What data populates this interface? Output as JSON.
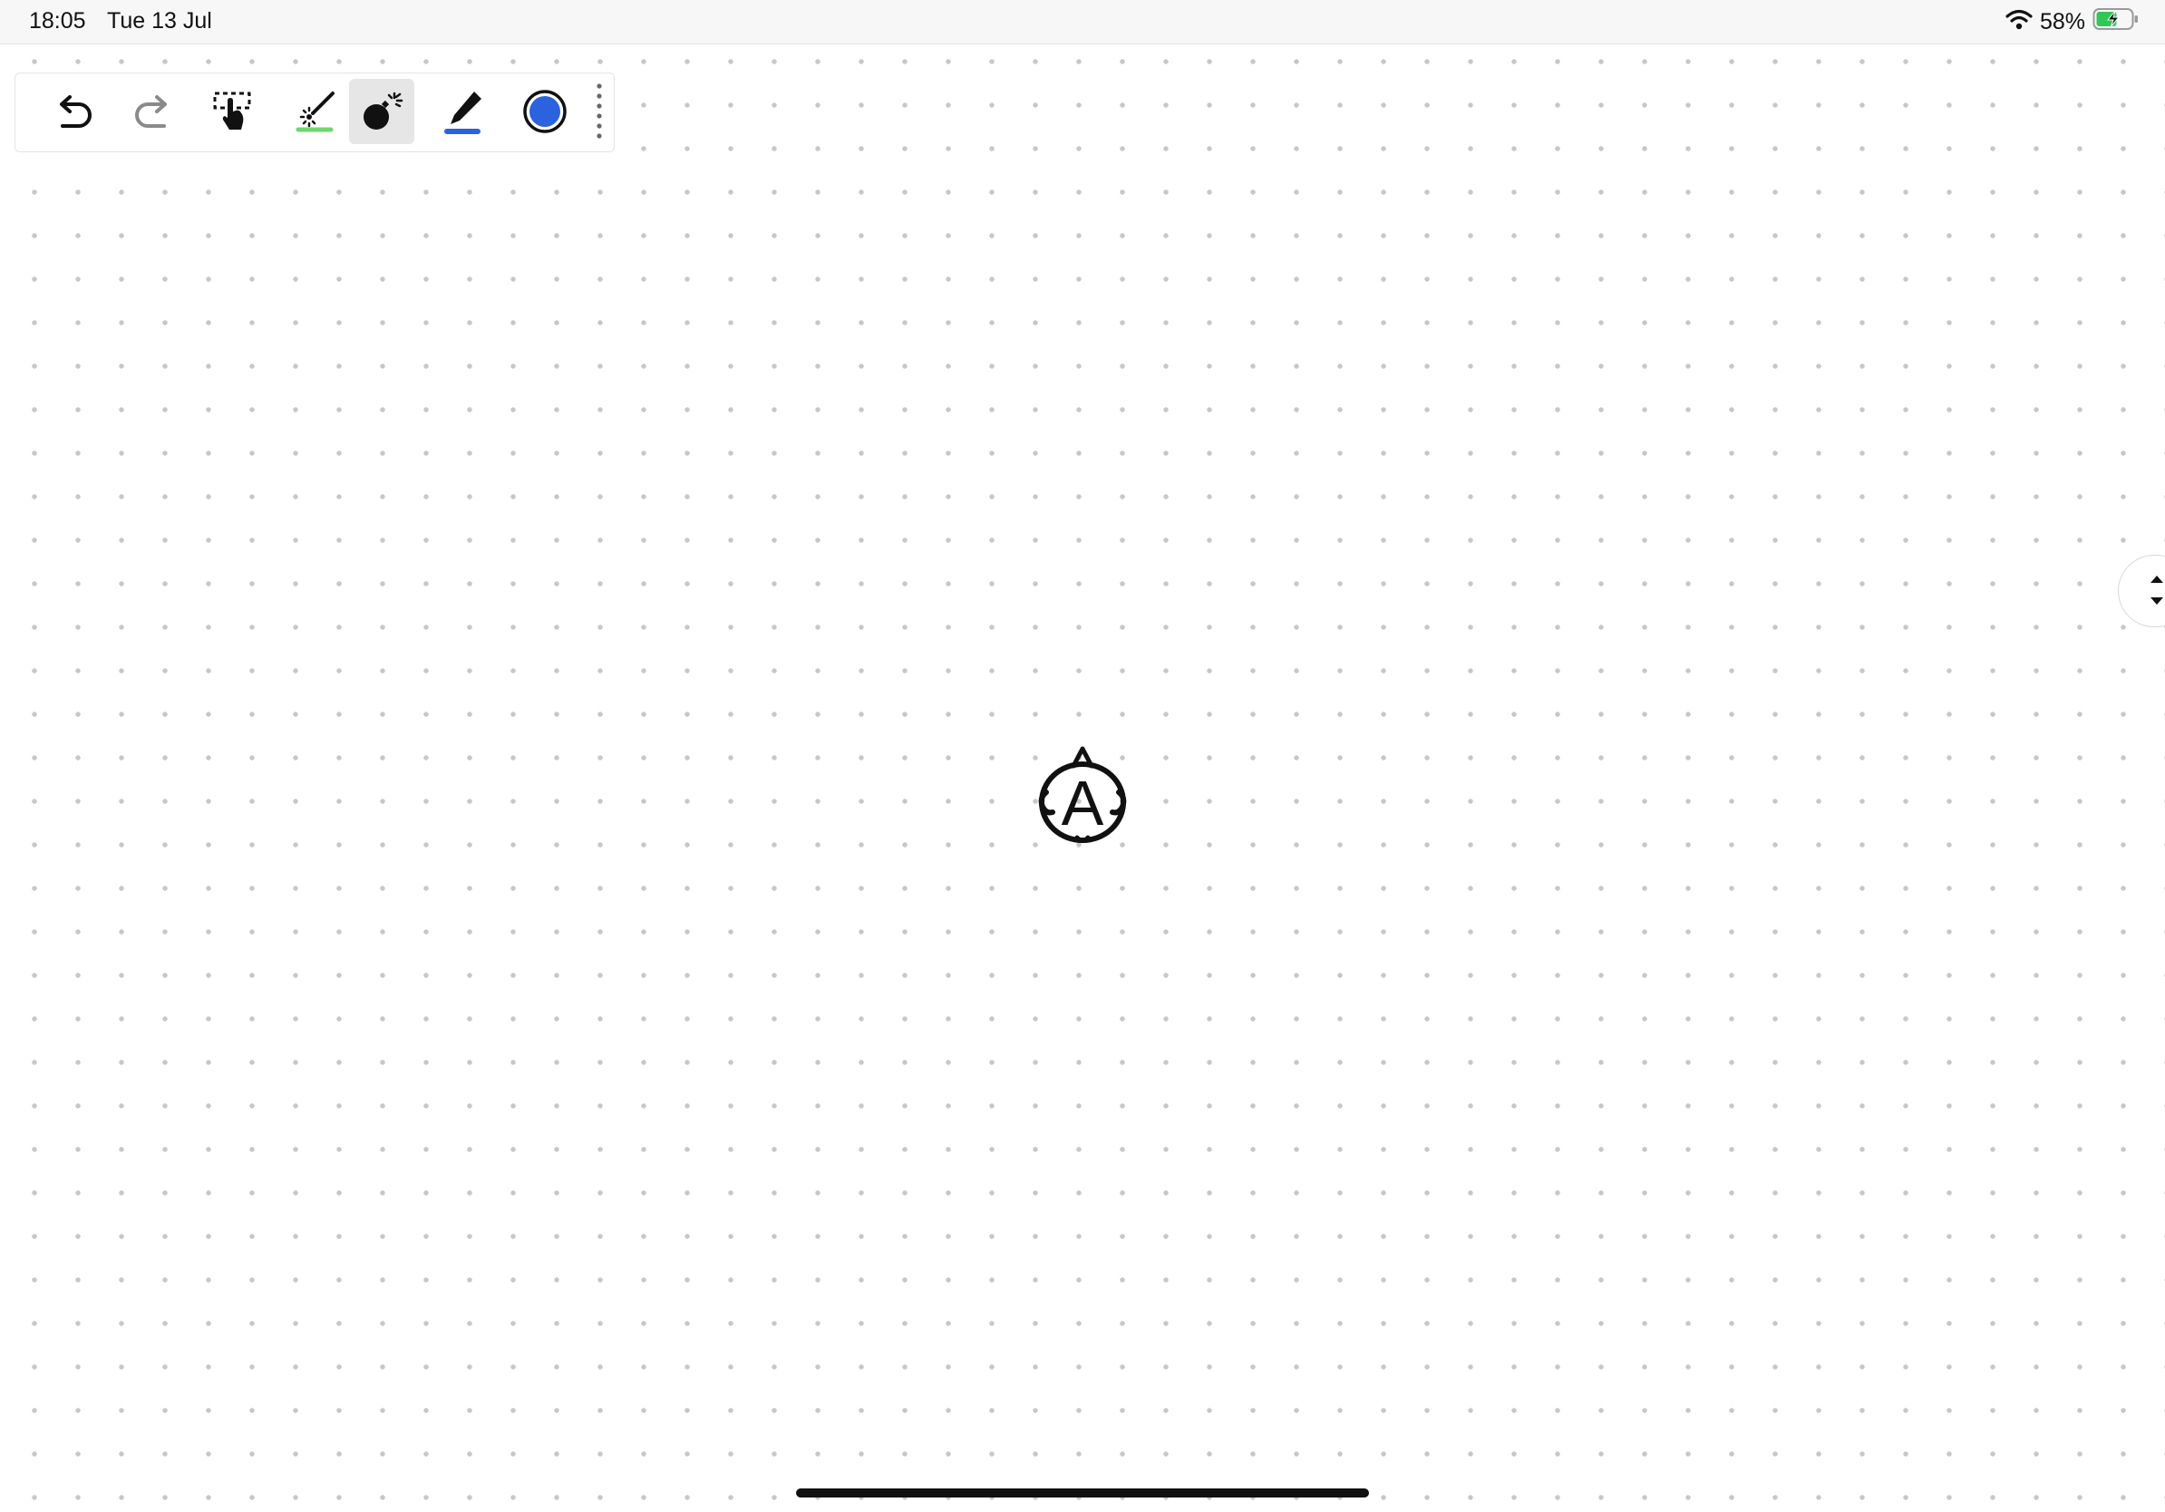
{
  "status_bar": {
    "time": "18:05",
    "date": "Tue 13 Jul",
    "battery_percent": "58%",
    "wifi_icon": "wifi-icon",
    "battery_icon": "battery-charging-icon",
    "battery_level": 0.58
  },
  "toolbar": {
    "tools": [
      {
        "name": "undo",
        "icon": "undo-arrow-icon"
      },
      {
        "name": "redo",
        "icon": "redo-arrow-icon"
      },
      {
        "name": "select",
        "icon": "lasso-select-hand-icon"
      },
      {
        "name": "laser-pointer",
        "icon": "laser-pointer-icon"
      },
      {
        "name": "bomb",
        "icon": "bomb-icon",
        "active": true
      },
      {
        "name": "pen",
        "icon": "marker-pen-icon"
      },
      {
        "name": "color",
        "icon": "color-swatch-icon"
      }
    ],
    "laser_accent": "#6fd66f",
    "pen_color": "#2b62e0",
    "swatch_color": "#2b62e0"
  },
  "canvas": {
    "background": "#ffffff",
    "dot_color": "#c7c7c7",
    "drawing_letter": "A",
    "drawing_icon": "anarchy-symbol-sketch-icon"
  },
  "side_handle": {
    "icon": "scroll-up-down-icon"
  }
}
